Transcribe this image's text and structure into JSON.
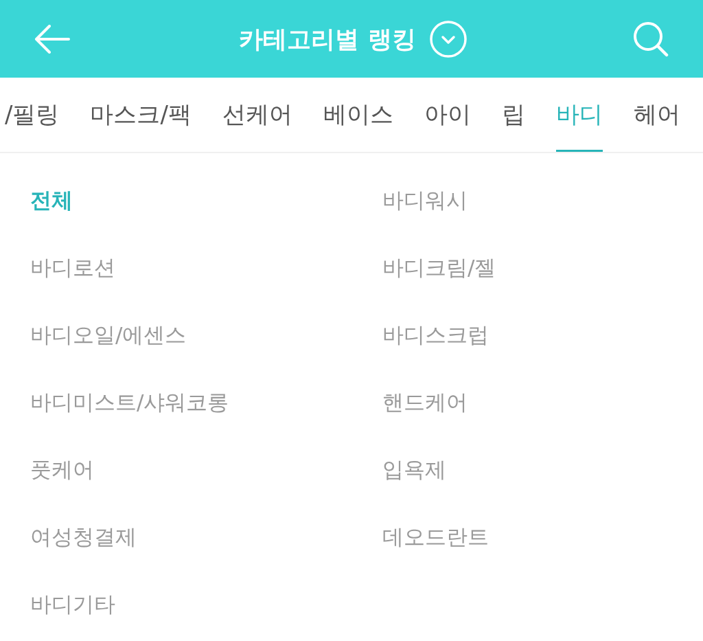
{
  "header": {
    "title": "카테고리별 랭킹"
  },
  "tabs": [
    {
      "label": "/필링",
      "selected": false
    },
    {
      "label": "마스크/팩",
      "selected": false
    },
    {
      "label": "선케어",
      "selected": false
    },
    {
      "label": "베이스",
      "selected": false
    },
    {
      "label": "아이",
      "selected": false
    },
    {
      "label": "립",
      "selected": false
    },
    {
      "label": "바디",
      "selected": true
    },
    {
      "label": "헤어",
      "selected": false
    }
  ],
  "subcategories": [
    {
      "label": "전체",
      "selected": true
    },
    {
      "label": "바디워시",
      "selected": false
    },
    {
      "label": "바디로션",
      "selected": false
    },
    {
      "label": "바디크림/젤",
      "selected": false
    },
    {
      "label": "바디오일/에센스",
      "selected": false
    },
    {
      "label": "바디스크럽",
      "selected": false
    },
    {
      "label": "바디미스트/샤워코롱",
      "selected": false
    },
    {
      "label": "핸드케어",
      "selected": false
    },
    {
      "label": "풋케어",
      "selected": false
    },
    {
      "label": "입욕제",
      "selected": false
    },
    {
      "label": "여성청결제",
      "selected": false
    },
    {
      "label": "데오드란트",
      "selected": false
    },
    {
      "label": "바디기타",
      "selected": false
    }
  ]
}
